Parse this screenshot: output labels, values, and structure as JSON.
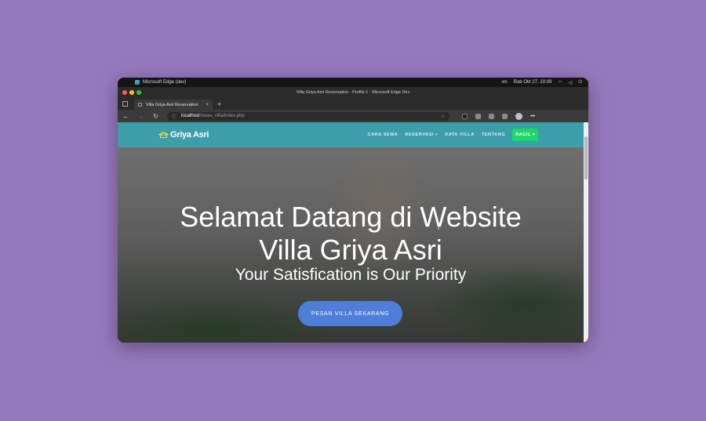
{
  "os_bar": {
    "app_name": "Microsoft Edge (dev)",
    "language": "en",
    "datetime": "Rab Okt 27, 20:09"
  },
  "window": {
    "title": "Villa Griya Asri Reservation - Profile 1 - Microsoft Edge Dev"
  },
  "tab": {
    "label": "Villa Griya Asri Reservation",
    "close": "×",
    "new_tab": "+"
  },
  "address_bar": {
    "host": "localhost",
    "path": "/sewa_villa/index.php"
  },
  "site": {
    "brand": "Griya Asri",
    "menu": [
      {
        "label": "CARA SEWA"
      },
      {
        "label": "RESERVASI"
      },
      {
        "label": "DATA VILLA"
      },
      {
        "label": "TENTANG"
      }
    ],
    "user_button": "RAGIL ▾"
  },
  "hero": {
    "title_line1": "Selamat Datang di Website",
    "title_line2": "Villa Griya Asri",
    "subtitle": "Your Satisfication is Our Priority",
    "cta": "PESAN VILLA SEKARANG"
  },
  "colors": {
    "desktop_bg": "#9579bd",
    "site_nav": "#3b9ea8",
    "user_button": "#1ed76a",
    "cta": "#4e7ed8"
  }
}
